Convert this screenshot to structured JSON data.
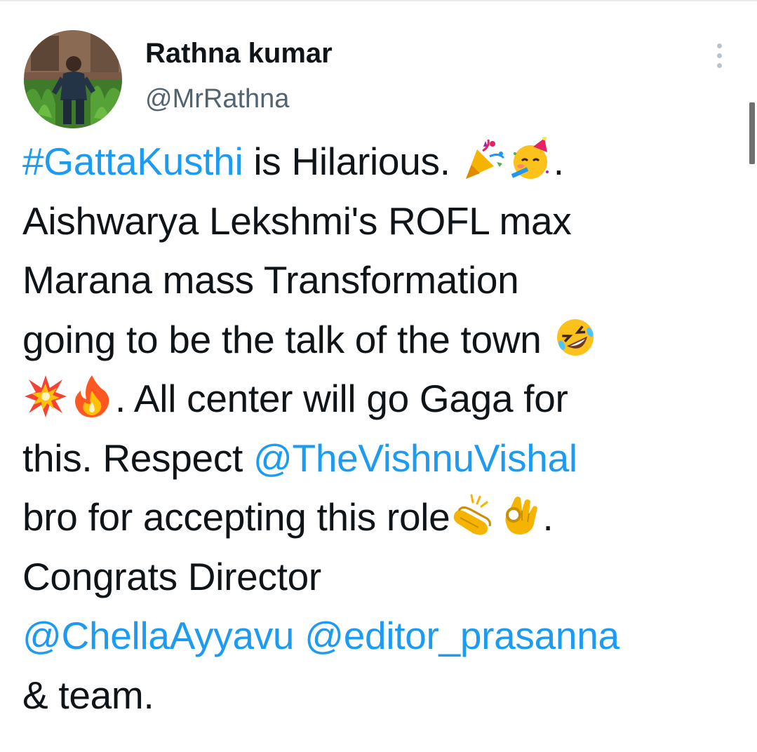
{
  "author": {
    "display_name": "Rathna kumar",
    "handle": "@MrRathna",
    "avatar_icon": "profile-photo-avatar"
  },
  "menu": {
    "more_icon": "vertical-ellipsis-icon"
  },
  "tweet": {
    "lines": [
      [
        {
          "type": "link",
          "text": "#GattaKusthi"
        },
        {
          "type": "text",
          "text": " is Hilarious. "
        },
        {
          "type": "emoji",
          "icon": "party-popper-emoji"
        },
        {
          "type": "emoji",
          "icon": "partying-face-emoji"
        },
        {
          "type": "text",
          "text": "."
        }
      ],
      [
        {
          "type": "text",
          "text": "Aishwarya Lekshmi's ROFL max"
        }
      ],
      [
        {
          "type": "text",
          "text": "Marana mass Transformation"
        }
      ],
      [
        {
          "type": "text",
          "text": "going to be the talk of the town "
        },
        {
          "type": "emoji",
          "icon": "rolling-on-floor-laughing-emoji"
        }
      ],
      [
        {
          "type": "emoji",
          "icon": "collision-emoji"
        },
        {
          "type": "emoji",
          "icon": "fire-emoji"
        },
        {
          "type": "text",
          "text": ". All center will go Gaga for"
        }
      ],
      [
        {
          "type": "text",
          "text": "this. Respect "
        },
        {
          "type": "link",
          "text": "@TheVishnuVishal"
        }
      ],
      [
        {
          "type": "text",
          "text": "bro for accepting this role"
        },
        {
          "type": "emoji",
          "icon": "clapping-hands-emoji"
        },
        {
          "type": "emoji",
          "icon": "ok-hand-emoji"
        },
        {
          "type": "text",
          "text": "."
        }
      ],
      [
        {
          "type": "text",
          "text": "Congrats Director"
        }
      ],
      [
        {
          "type": "link",
          "text": "@ChellaAyyavu"
        },
        {
          "type": "text",
          "text": " "
        },
        {
          "type": "link",
          "text": "@editor_prasanna"
        }
      ],
      [
        {
          "type": "text",
          "text": "& team."
        }
      ]
    ]
  },
  "colors": {
    "text": "#0f1419",
    "link": "#1d9bf0",
    "secondary": "#536471"
  }
}
